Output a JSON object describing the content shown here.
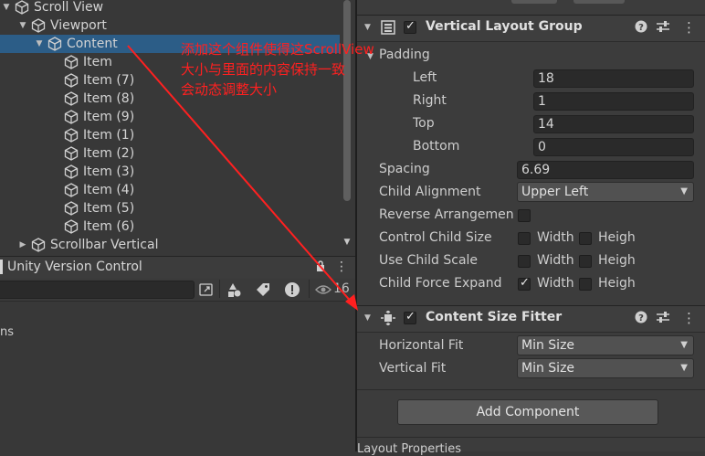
{
  "hierarchy": {
    "items": [
      {
        "label": "Scroll View",
        "indent": 0,
        "arrow": "▼",
        "selected": false
      },
      {
        "label": "Viewport",
        "indent": 1,
        "arrow": "▼",
        "selected": false
      },
      {
        "label": "Content",
        "indent": 2,
        "arrow": "▼",
        "selected": true
      },
      {
        "label": "Item",
        "indent": 3,
        "arrow": "",
        "selected": false
      },
      {
        "label": "Item (7)",
        "indent": 3,
        "arrow": "",
        "selected": false
      },
      {
        "label": "Item (8)",
        "indent": 3,
        "arrow": "",
        "selected": false
      },
      {
        "label": "Item (9)",
        "indent": 3,
        "arrow": "",
        "selected": false
      },
      {
        "label": "Item (1)",
        "indent": 3,
        "arrow": "",
        "selected": false
      },
      {
        "label": "Item (2)",
        "indent": 3,
        "arrow": "",
        "selected": false
      },
      {
        "label": "Item (3)",
        "indent": 3,
        "arrow": "",
        "selected": false
      },
      {
        "label": "Item (4)",
        "indent": 3,
        "arrow": "",
        "selected": false
      },
      {
        "label": "Item (5)",
        "indent": 3,
        "arrow": "",
        "selected": false
      },
      {
        "label": "Item (6)",
        "indent": 3,
        "arrow": "",
        "selected": false
      },
      {
        "label": "Scrollbar Vertical",
        "indent": 1,
        "arrow": "▶",
        "selected": false
      }
    ]
  },
  "version_control": {
    "title": "Unity Version Control",
    "visible_count": "16",
    "partial_text": "ns"
  },
  "annotation": {
    "text_line1": "添加这个组件使得这ScrollView",
    "text_line2": "大小与里面的内容保持一致",
    "text_line3": "会动态调整大小",
    "color": "#ff2020"
  },
  "inspector": {
    "vertical_layout_group": {
      "title": "Vertical Layout Group",
      "enabled": true,
      "padding_label": "Padding",
      "left_label": "Left",
      "left_value": "18",
      "right_label": "Right",
      "right_value": "1",
      "top_label": "Top",
      "top_value": "14",
      "bottom_label": "Bottom",
      "bottom_value": "0",
      "spacing_label": "Spacing",
      "spacing_value": "6.69",
      "child_alignment_label": "Child Alignment",
      "child_alignment_value": "Upper Left",
      "reverse_label": "Reverse Arrangemen",
      "control_child_size_label": "Control Child Size",
      "use_child_scale_label": "Use Child Scale",
      "child_force_expand_label": "Child Force Expand",
      "width_label": "Width",
      "height_label": "Heigh",
      "control_child_size_width": false,
      "control_child_size_height": false,
      "use_child_scale_width": false,
      "use_child_scale_height": false,
      "child_force_expand_width": true,
      "child_force_expand_height": false
    },
    "content_size_fitter": {
      "title": "Content Size Fitter",
      "enabled": true,
      "horizontal_fit_label": "Horizontal Fit",
      "horizontal_fit_value": "Min Size",
      "vertical_fit_label": "Vertical Fit",
      "vertical_fit_value": "Min Size"
    },
    "add_component_label": "Add Component",
    "bottom_partial": "Layout Properties"
  },
  "icons": {
    "help": "help-icon",
    "presets": "presets-icon",
    "more": "more-vert-icon",
    "cube": "gameobject-cube-icon"
  }
}
